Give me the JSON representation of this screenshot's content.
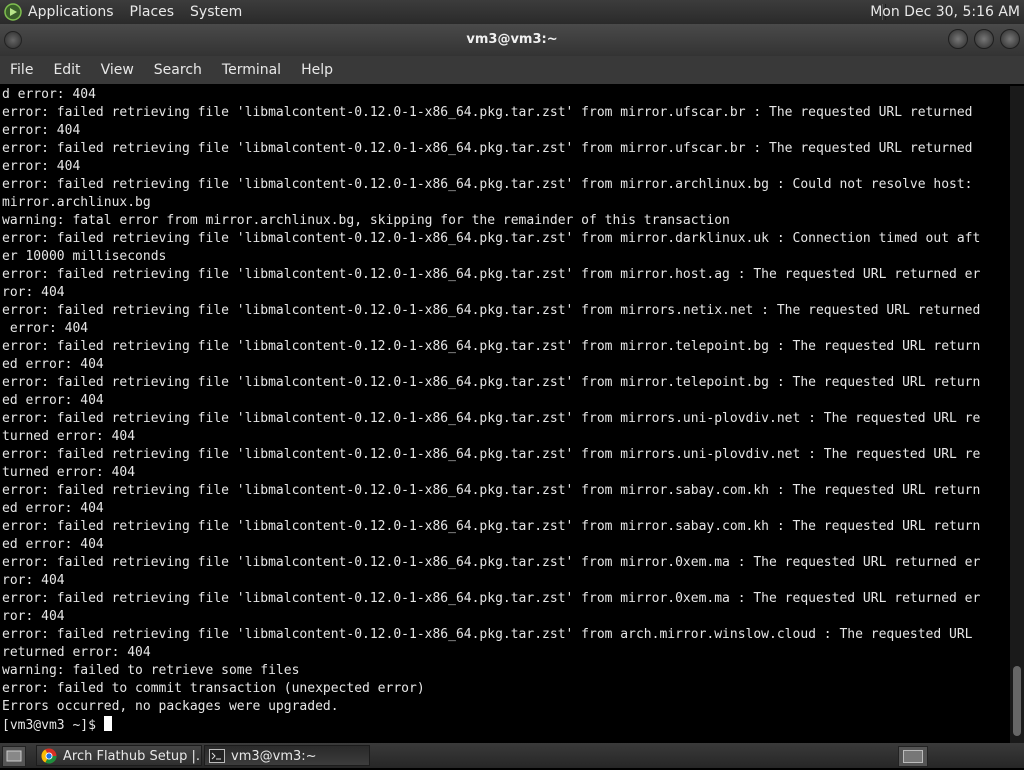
{
  "top_panel": {
    "menus": [
      "Applications",
      "Places",
      "System"
    ],
    "clock": "Mon Dec 30,  5:16 AM"
  },
  "window": {
    "title": "vm3@vm3:~",
    "menu": [
      "File",
      "Edit",
      "View",
      "Search",
      "Terminal",
      "Help"
    ]
  },
  "terminal": {
    "lines": [
      "d error: 404",
      "error: failed retrieving file 'libmalcontent-0.12.0-1-x86_64.pkg.tar.zst' from mirror.ufscar.br : The requested URL returned",
      "error: 404",
      "error: failed retrieving file 'libmalcontent-0.12.0-1-x86_64.pkg.tar.zst' from mirror.ufscar.br : The requested URL returned",
      "error: 404",
      "error: failed retrieving file 'libmalcontent-0.12.0-1-x86_64.pkg.tar.zst' from mirror.archlinux.bg : Could not resolve host:",
      "mirror.archlinux.bg",
      "warning: fatal error from mirror.archlinux.bg, skipping for the remainder of this transaction",
      "error: failed retrieving file 'libmalcontent-0.12.0-1-x86_64.pkg.tar.zst' from mirror.darklinux.uk : Connection timed out aft",
      "er 10000 milliseconds",
      "error: failed retrieving file 'libmalcontent-0.12.0-1-x86_64.pkg.tar.zst' from mirror.host.ag : The requested URL returned er",
      "ror: 404",
      "error: failed retrieving file 'libmalcontent-0.12.0-1-x86_64.pkg.tar.zst' from mirrors.netix.net : The requested URL returned",
      " error: 404",
      "error: failed retrieving file 'libmalcontent-0.12.0-1-x86_64.pkg.tar.zst' from mirror.telepoint.bg : The requested URL return",
      "ed error: 404",
      "error: failed retrieving file 'libmalcontent-0.12.0-1-x86_64.pkg.tar.zst' from mirror.telepoint.bg : The requested URL return",
      "ed error: 404",
      "error: failed retrieving file 'libmalcontent-0.12.0-1-x86_64.pkg.tar.zst' from mirrors.uni-plovdiv.net : The requested URL re",
      "turned error: 404",
      "error: failed retrieving file 'libmalcontent-0.12.0-1-x86_64.pkg.tar.zst' from mirrors.uni-plovdiv.net : The requested URL re",
      "turned error: 404",
      "error: failed retrieving file 'libmalcontent-0.12.0-1-x86_64.pkg.tar.zst' from mirror.sabay.com.kh : The requested URL return",
      "ed error: 404",
      "error: failed retrieving file 'libmalcontent-0.12.0-1-x86_64.pkg.tar.zst' from mirror.sabay.com.kh : The requested URL return",
      "ed error: 404",
      "error: failed retrieving file 'libmalcontent-0.12.0-1-x86_64.pkg.tar.zst' from mirror.0xem.ma : The requested URL returned er",
      "ror: 404",
      "error: failed retrieving file 'libmalcontent-0.12.0-1-x86_64.pkg.tar.zst' from mirror.0xem.ma : The requested URL returned er",
      "ror: 404",
      "error: failed retrieving file 'libmalcontent-0.12.0-1-x86_64.pkg.tar.zst' from arch.mirror.winslow.cloud : The requested URL",
      "returned error: 404",
      "warning: failed to retrieve some files",
      "error: failed to commit transaction (unexpected error)",
      "Errors occurred, no packages were upgraded."
    ],
    "prompt": "[vm3@vm3 ~]$ "
  },
  "taskbar": {
    "tasks": [
      {
        "label": "Arch Flathub Setup |...",
        "icon": "chrome-icon"
      },
      {
        "label": "vm3@vm3:~",
        "icon": "terminal-icon"
      }
    ]
  }
}
